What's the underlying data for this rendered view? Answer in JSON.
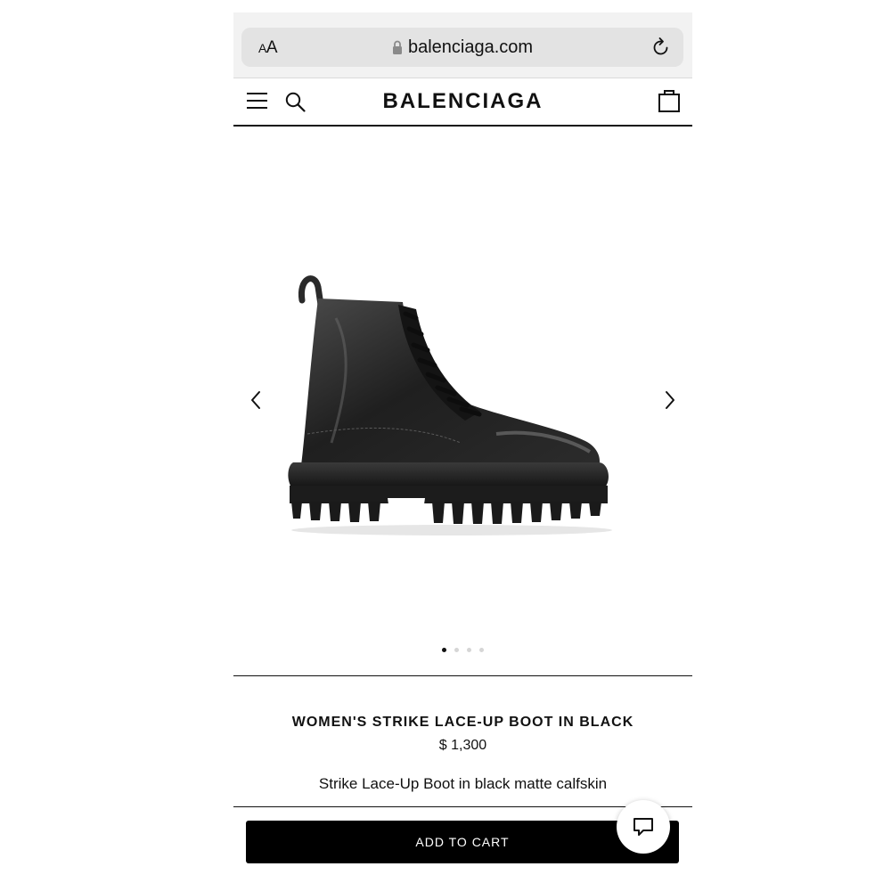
{
  "browser": {
    "text_size_label": "AA",
    "url": "balenciaga.com"
  },
  "header": {
    "brand": "BALENCIAGA"
  },
  "gallery": {
    "image": "boot-image",
    "slide_count": 4,
    "active_slide": 1
  },
  "product": {
    "title": "WOMEN'S STRIKE LACE-UP BOOT IN BLACK",
    "price": "$ 1,300",
    "description": "Strike Lace-Up Boot in black matte calfskin"
  },
  "actions": {
    "add_to_cart_label": "ADD TO CART"
  },
  "icons": [
    "lock-icon",
    "reload-icon",
    "menu-icon",
    "search-icon",
    "shopping-bag-icon",
    "chevron-left-icon",
    "chevron-right-icon",
    "chat-icon"
  ],
  "colors": {
    "primary": "#000000",
    "background": "#ffffff",
    "browser_bar": "#f2f2f2"
  }
}
